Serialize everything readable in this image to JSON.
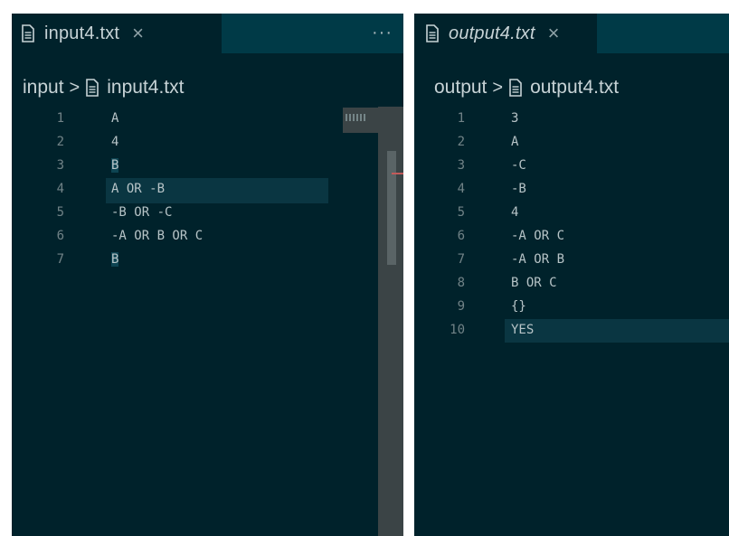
{
  "colors": {
    "editor_bg": "#00222b",
    "tabbar_bg": "#003a47",
    "text": "#c7d3d6",
    "line_number": "#718387",
    "current_line": "#0a3642",
    "token_highlight": "#0d4452",
    "scrollbar_track": "#3b4446"
  },
  "left_pane": {
    "tab": {
      "label": "input4.txt",
      "close_icon": "×",
      "file_icon": "file-icon"
    },
    "more_actions": "···",
    "breadcrumb": {
      "folder": "input",
      "separator": ">",
      "file": "input4.txt"
    },
    "lines": [
      {
        "number": "1",
        "text": "A"
      },
      {
        "number": "2",
        "text": "4"
      },
      {
        "number": "3",
        "text": "B"
      },
      {
        "number": "4",
        "text": "A OR -B"
      },
      {
        "number": "5",
        "text": "-B OR -C"
      },
      {
        "number": "6",
        "text": "-A OR B OR C"
      },
      {
        "number": "7",
        "text": "B"
      }
    ]
  },
  "right_pane": {
    "tab": {
      "label": "output4.txt",
      "close_icon": "×",
      "file_icon": "file-icon",
      "preview": true
    },
    "breadcrumb": {
      "folder": "output",
      "separator": ">",
      "file": "output4.txt"
    },
    "lines": [
      {
        "number": "1",
        "text": "3"
      },
      {
        "number": "2",
        "text": "A"
      },
      {
        "number": "3",
        "text": "-C"
      },
      {
        "number": "4",
        "text": "-B"
      },
      {
        "number": "5",
        "text": "4"
      },
      {
        "number": "6",
        "text": "-A OR C"
      },
      {
        "number": "7",
        "text": "-A OR B"
      },
      {
        "number": "8",
        "text": "B OR C"
      },
      {
        "number": "9",
        "text": "{}"
      },
      {
        "number": "10",
        "text": "YES"
      }
    ]
  }
}
